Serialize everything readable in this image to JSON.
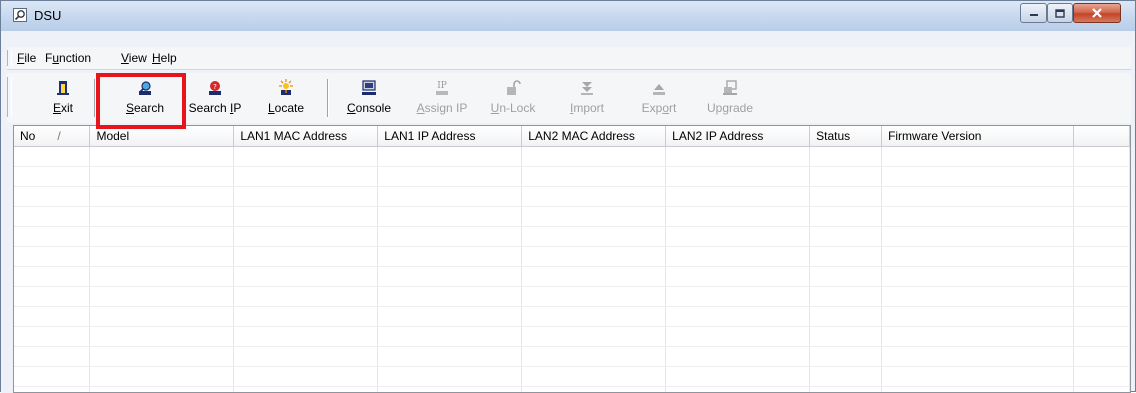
{
  "window": {
    "title": "DSU"
  },
  "menu": [
    {
      "label": "File",
      "accel": "F",
      "rest": "ile"
    },
    {
      "label": "Function",
      "accel": "u",
      "pre": "F",
      "rest": "nction"
    },
    {
      "label": "View",
      "accel": "V",
      "rest": "iew"
    },
    {
      "label": "Help",
      "accel": "H",
      "rest": "elp"
    }
  ],
  "toolbar": {
    "exit": {
      "label": "Exit",
      "accel": "E",
      "rest": "xit",
      "icon": "exit-icon"
    },
    "search": {
      "label": "Search",
      "accel": "S",
      "rest": "earch",
      "icon": "search-icon"
    },
    "search_ip": {
      "label": "Search IP",
      "pre": "Search ",
      "accel": "I",
      "rest": "P",
      "icon": "search-ip-icon"
    },
    "locate": {
      "label": "Locate",
      "accel": "L",
      "rest": "ocate",
      "icon": "locate-icon"
    },
    "console": {
      "label": "Console",
      "accel": "C",
      "rest": "onsole",
      "icon": "console-icon"
    },
    "assign_ip": {
      "label": "Assign IP",
      "pre": "",
      "accel": "A",
      "rest": "ssign IP",
      "icon": "assign-ip-icon",
      "disabled": true
    },
    "unlock": {
      "label": "Un-Lock",
      "accel": "U",
      "rest": "n-Lock",
      "icon": "unlock-icon",
      "disabled": true
    },
    "import": {
      "label": "Import",
      "accel": "I",
      "rest": "mport",
      "icon": "import-icon",
      "disabled": true
    },
    "export": {
      "label": "Export",
      "pre": "Exp",
      "accel": "o",
      "rest": "rt",
      "icon": "export-icon",
      "disabled": true
    },
    "upgrade": {
      "label": "Upgrade",
      "pre": "Up",
      "accel": "g",
      "rest": "rade",
      "icon": "upgrade-icon",
      "disabled": true
    }
  },
  "table": {
    "columns": [
      "No",
      "Model",
      "LAN1 MAC Address",
      "LAN1 IP Address",
      "LAN2 MAC Address",
      "LAN2 IP Address",
      "Status",
      "Firmware Version"
    ],
    "sort_indicator": "/",
    "rows": []
  },
  "colors": {
    "highlight": "#e8141b",
    "window_bg": "#eef2f8"
  }
}
